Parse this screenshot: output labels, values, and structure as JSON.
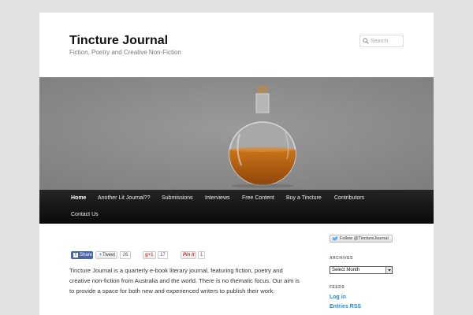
{
  "site": {
    "title": "Tincture Journal",
    "description": "Fiction, Poetry and Creative Non-Fiction"
  },
  "search": {
    "placeholder": "Search",
    "icon": "search-icon"
  },
  "header_image": {
    "subject": "round glass bottle with cork stopper, partly filled with amber liquid",
    "background_color": "#8e8e8e",
    "liquid_color": "#b8620f"
  },
  "nav": {
    "items": [
      {
        "label": "Home",
        "current": true
      },
      {
        "label": "Another Lit Journal??"
      },
      {
        "label": "Submissions"
      },
      {
        "label": "Interviews"
      },
      {
        "label": "Free Content"
      },
      {
        "label": "Buy a Tincture"
      },
      {
        "label": "Contributors"
      },
      {
        "label": "Contact Us"
      }
    ]
  },
  "share": {
    "facebook_label": "Share",
    "tweet_label": "Tweet",
    "tweet_count": "26",
    "gplus_label": "+1",
    "gplus_count": "17",
    "pinterest_label": "Pin it",
    "pinterest_count": "1"
  },
  "content": {
    "intro": "Tincture Journal is a quarterly e-book literary journal, featuring fiction, poetry and creative non-fiction from Australia and the world. There is no thematic focus. Our aim is to provide a space for both new and experienced writers to publish their work."
  },
  "sidebar": {
    "follow_label": "Follow @TinctureJournal",
    "archives_title": "ARCHIVES",
    "archives_select": "Select Month",
    "feeds_title": "FEEDS",
    "feeds": [
      "Log in",
      "Entries RSS"
    ]
  },
  "colors": {
    "link": "#1b8be0",
    "nav_bg": "#151515",
    "page_bg": "#e2e2e2"
  }
}
